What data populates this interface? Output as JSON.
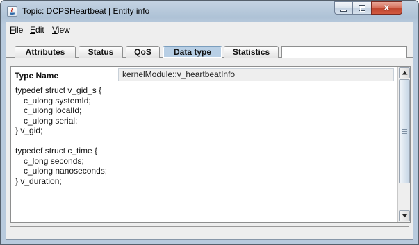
{
  "window": {
    "title": "Topic: DCPSHeartbeat | Entity info",
    "close_glyph": "x",
    "colors": {
      "frame": "#b8cadd",
      "close_button": "#c9513a",
      "selected_tab": "#b8cfe5"
    },
    "icons": [
      "java-app-icon",
      "minimize-icon",
      "maximize-icon",
      "close-icon"
    ]
  },
  "menu": {
    "items": [
      {
        "label": "File",
        "mnemonic": "F",
        "rest": "ile"
      },
      {
        "label": "Edit",
        "mnemonic": "E",
        "rest": "dit"
      },
      {
        "label": "View",
        "mnemonic": "V",
        "rest": "iew"
      }
    ]
  },
  "tabs": [
    {
      "label": "Attributes",
      "selected": false
    },
    {
      "label": "Status",
      "selected": false
    },
    {
      "label": "QoS",
      "selected": false
    },
    {
      "label": "Data type",
      "selected": true
    },
    {
      "label": "Statistics",
      "selected": false
    }
  ],
  "datatype": {
    "type_name_label": "Type Name",
    "type_name_value": "kernelModule::v_heartbeatInfo",
    "code_lines": [
      {
        "text": "typedef struct v_gid_s {",
        "indent": false
      },
      {
        "text": "c_ulong systemId;",
        "indent": true
      },
      {
        "text": "c_ulong localId;",
        "indent": true
      },
      {
        "text": "c_ulong serial;",
        "indent": true
      },
      {
        "text": "} v_gid;",
        "indent": false
      },
      {
        "text": "",
        "indent": false
      },
      {
        "text": "typedef struct c_time {",
        "indent": false
      },
      {
        "text": "c_long seconds;",
        "indent": true
      },
      {
        "text": "c_ulong nanoseconds;",
        "indent": true
      },
      {
        "text": "} v_duration;",
        "indent": false
      }
    ]
  },
  "status": {
    "text": ""
  }
}
